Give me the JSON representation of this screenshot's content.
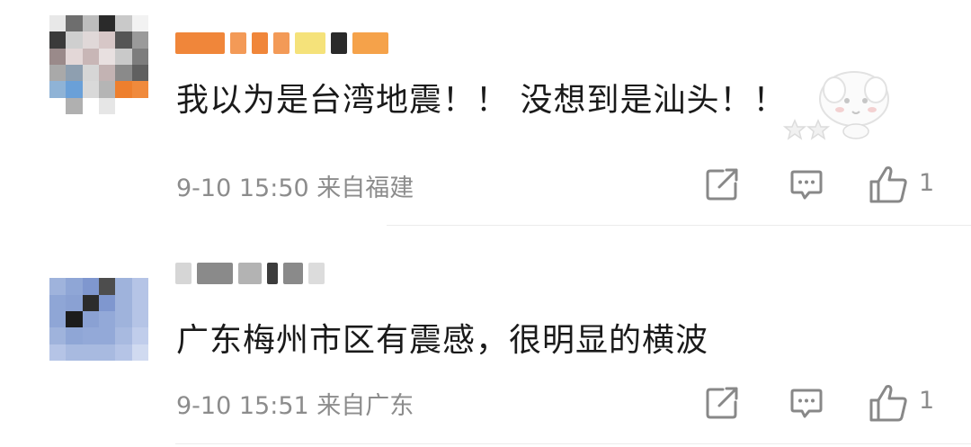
{
  "comments": [
    {
      "text": "我以为是台湾地震！！ 没想到是汕头！！",
      "time": "9-10 15:50",
      "location": "来自福建",
      "like_count": "1",
      "has_sticker": true
    },
    {
      "text": "广东梅州市区有震感，很明显的横波",
      "time": "9-10 15:51",
      "location": "来自广东",
      "like_count": "1",
      "has_sticker": false
    }
  ],
  "icons": {
    "share": "share-icon",
    "reply": "reply-icon",
    "like": "thumbs-up-icon"
  },
  "colors": {
    "text": "#1a1a1a",
    "meta": "#8c8c8c",
    "icon": "#888888",
    "divider": "#ececec"
  }
}
